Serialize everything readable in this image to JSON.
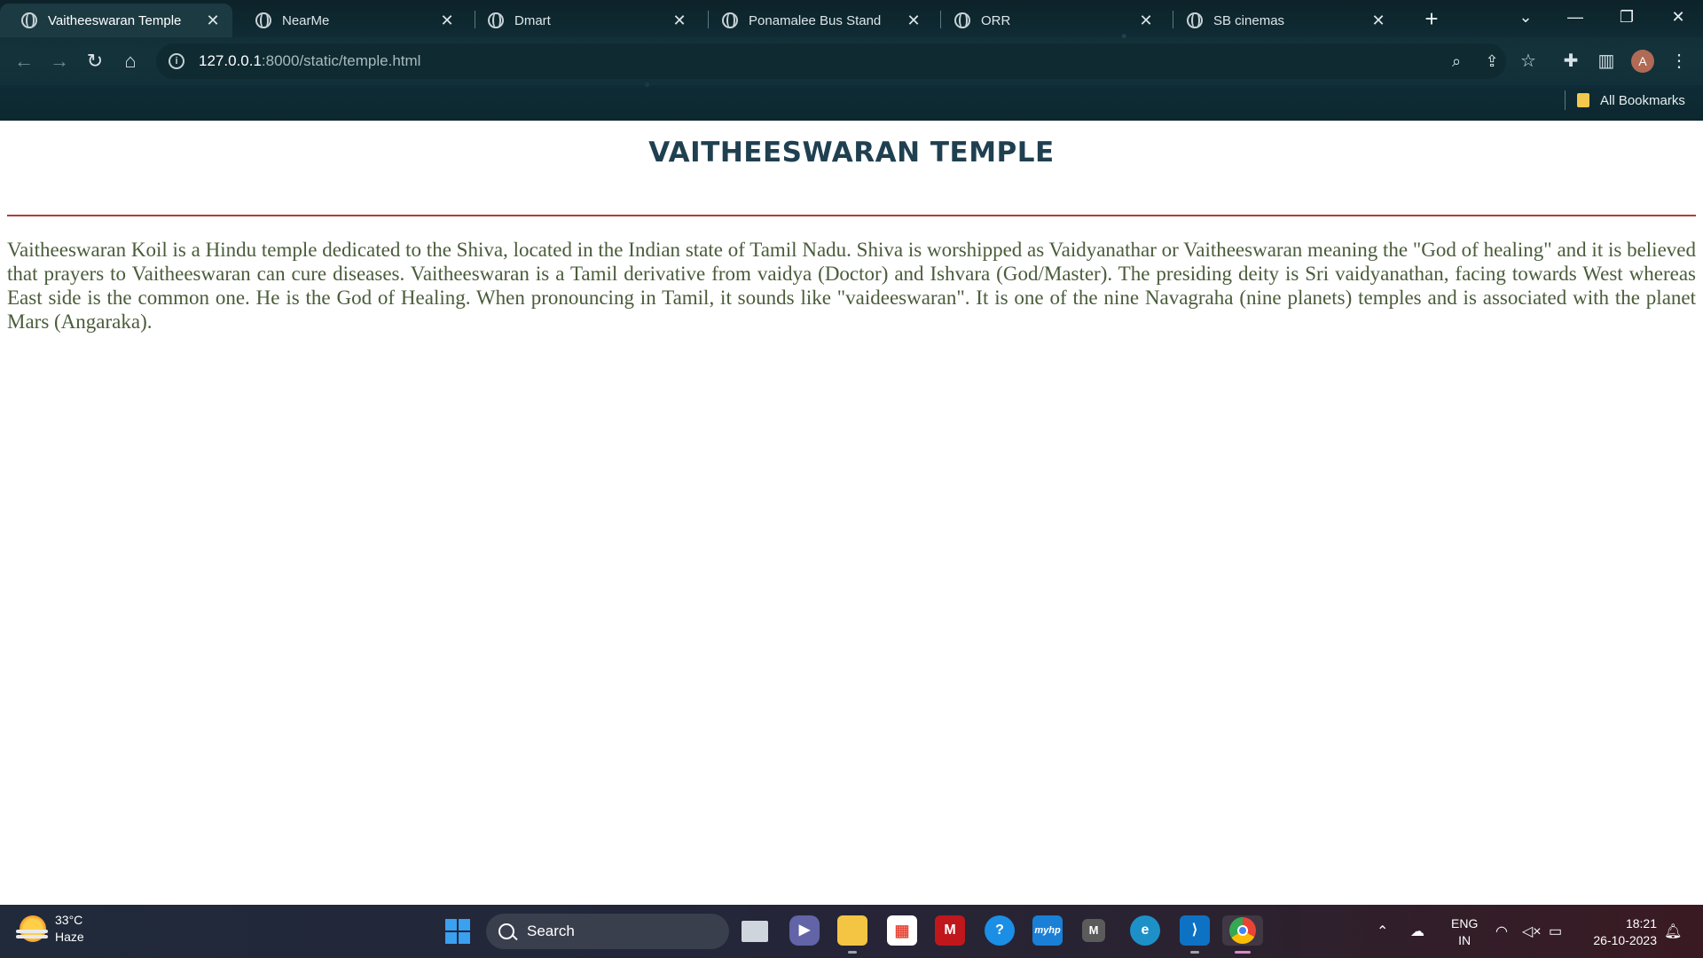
{
  "browser": {
    "tabs": [
      {
        "title": "Vaitheeswaran Temple",
        "active": true
      },
      {
        "title": "NearMe",
        "active": false
      },
      {
        "title": "Dmart",
        "active": false
      },
      {
        "title": "Ponamalee Bus Stand",
        "active": false
      },
      {
        "title": "ORR",
        "active": false
      },
      {
        "title": "SB cinemas",
        "active": false
      }
    ],
    "address": {
      "host": "127.0.0.1",
      "path": ":8000/static/temple.html"
    },
    "bookmarks_label": "All Bookmarks",
    "profile_initial": "A"
  },
  "page": {
    "heading": "VAITHEESWARAN TEMPLE",
    "paragraph": "Vaitheeswaran Koil is a Hindu temple dedicated to the Shiva, located in the Indian state of Tamil Nadu. Shiva is worshipped as Vaidyanathar or Vaitheeswaran meaning the \"God of healing\" and it is believed that prayers to Vaitheeswaran can cure diseases. Vaitheeswaran is a Tamil derivative from vaidya (Doctor) and Ishvara (God/Master). The presiding deity is Sri vaidyanathan, facing towards West whereas East side is the common one. He is the God of Healing. When pronouncing in Tamil, it sounds like \"vaideeswaran\". It is one of the nine Navagraha (nine planets) temples and is associated with the planet Mars (Angaraka).",
    "colors": {
      "heading": "#1f4050",
      "rule": "#b33a3a",
      "text": "#4a5c3a"
    }
  },
  "taskbar": {
    "weather": {
      "temp": "33°C",
      "condition": "Haze"
    },
    "search_label": "Search",
    "lang_top": "ENG",
    "lang_bottom": "IN",
    "time": "18:21",
    "date": "26-10-2023",
    "apps": [
      "task-view",
      "teams",
      "file-explorer",
      "microsoft-store",
      "mcafee",
      "help",
      "myhp",
      "m-app",
      "edge",
      "vscode",
      "chrome"
    ]
  }
}
